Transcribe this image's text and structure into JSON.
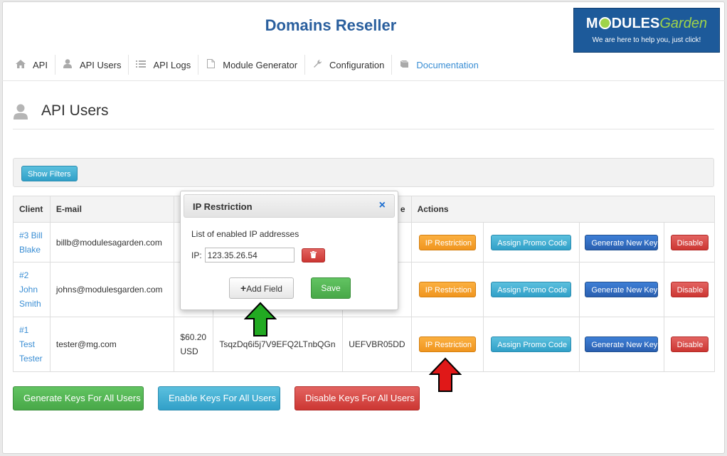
{
  "app": {
    "title": "Domains Reseller",
    "logo": {
      "word_main": "M",
      "word_rest": "DULES",
      "word_garden": "Garden",
      "tagline": "We are here to help you, just click!"
    }
  },
  "nav": {
    "items": [
      {
        "label": "API",
        "icon": "home-icon"
      },
      {
        "label": "API Users",
        "icon": "user-icon"
      },
      {
        "label": "API Logs",
        "icon": "list-icon"
      },
      {
        "label": "Module Generator",
        "icon": "file-icon"
      },
      {
        "label": "Configuration",
        "icon": "wrench-icon"
      },
      {
        "label": "Documentation",
        "icon": "book-icon",
        "active": true
      }
    ]
  },
  "page": {
    "title": "API Users",
    "show_filters": "Show Filters"
  },
  "table": {
    "headers": [
      "Client",
      "E-mail",
      "",
      "",
      "e",
      "Actions"
    ],
    "rows": [
      {
        "client": [
          "#3 Bill",
          "Blake"
        ],
        "email": "billb@modulesagarden.com",
        "credit": "",
        "key": "",
        "code": ""
      },
      {
        "client": [
          "#2",
          "John",
          "Smith"
        ],
        "email": "johns@modulesgarden.com",
        "credit": "",
        "key": "",
        "code": ""
      },
      {
        "client": [
          "#1",
          "Test",
          "Tester"
        ],
        "email": "tester@mg.com",
        "credit": [
          "$60.20",
          "USD"
        ],
        "key": "TsqzDq6i5j7V9EFQ2LTnbQGn",
        "code": "UEFVBR05DD"
      }
    ],
    "actions": {
      "ip_restriction": "IP Restriction",
      "assign_promo": "Assign Promo Code",
      "generate_key": "Generate New Key",
      "disable": "Disable"
    }
  },
  "bottom": {
    "generate_all": "Generate Keys For All Users",
    "enable_all": "Enable Keys For All Users",
    "disable_all": "Disable Keys For All Users"
  },
  "modal": {
    "title": "IP Restriction",
    "close": "×",
    "list_label": "List of enabled IP addresses",
    "ip_label": "IP:",
    "ip_value": "123.35.26.54",
    "add_field": "Add Field",
    "add_field_icon": "+",
    "save": "Save"
  },
  "colors": {
    "title_blue": "#2a5f9e",
    "link_blue": "#3a8ed4",
    "arrow_green": "#22aa22",
    "arrow_red": "#e01818"
  }
}
